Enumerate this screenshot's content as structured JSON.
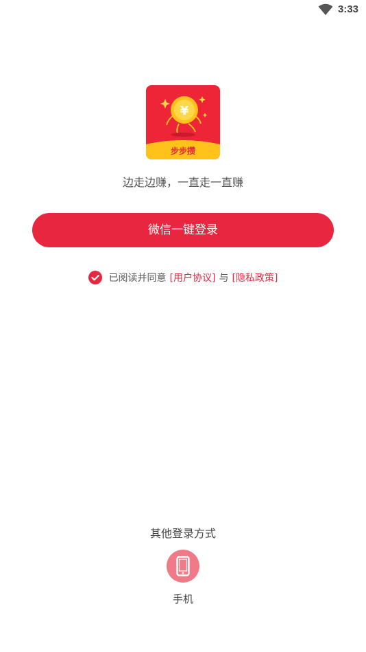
{
  "status_bar": {
    "time": "3:33",
    "wifi_icon": "wifi-icon"
  },
  "app": {
    "logo_text": "步步攒",
    "slogan": "边走边赚，一直走一直赚"
  },
  "login": {
    "wechat_button_label": "微信一键登录"
  },
  "agreement": {
    "checked": true,
    "prefix": "已阅读并同意",
    "user_agreement": "[用户协议]",
    "conjunction": "与",
    "privacy_policy": "[隐私政策]"
  },
  "other_login": {
    "title": "其他登录方式",
    "phone_label": "手机",
    "phone_icon": "smartphone-icon"
  },
  "colors": {
    "primary": "#e8263f",
    "phone_circle": "#ef7b89",
    "logo_bg": "#ee2437",
    "logo_coin": "#ffc21a"
  }
}
